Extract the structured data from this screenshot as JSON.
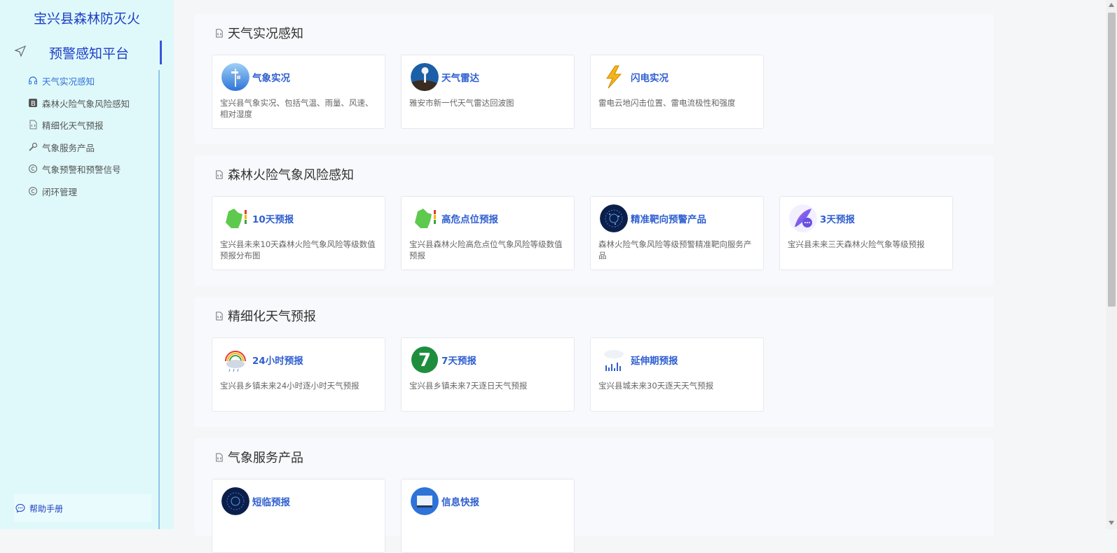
{
  "sidebar": {
    "title": "宝兴县森林防灭火",
    "platform": "预警感知平台",
    "items": [
      {
        "label": "天气实况感知",
        "icon": "headset-icon"
      },
      {
        "label": "森林火险气象风险感知",
        "icon": "b-badge-icon"
      },
      {
        "label": "精细化天气预报",
        "icon": "code-file-icon"
      },
      {
        "label": "气象服务产品",
        "icon": "wrench-icon"
      },
      {
        "label": "气象预警和预警信号",
        "icon": "copyright-icon"
      },
      {
        "label": "闭环管理",
        "icon": "copyright-icon"
      }
    ],
    "help": "帮助手册"
  },
  "sections": [
    {
      "title": "天气实况感知",
      "cards": [
        {
          "name": "气象实况",
          "desc": "宝兴县气象实况、包括气温、雨量、风速、相对湿度"
        },
        {
          "name": "天气雷达",
          "desc": "雅安市新一代天气雷达回波图"
        },
        {
          "name": "闪电实况",
          "desc": "雷电云地闪击位置、雷电流极性和强度"
        }
      ]
    },
    {
      "title": "森林火险气象风险感知",
      "cards": [
        {
          "name": "10天预报",
          "desc": "宝兴县未来10天森林火险气象风险等级数值预报分布图"
        },
        {
          "name": "高危点位预报",
          "desc": "宝兴县森林火险高危点位气象风险等级数值预报"
        },
        {
          "name": "精准靶向预警产品",
          "desc": "森林火险气象风险等级预警精准靶向服务产品"
        },
        {
          "name": "3天预报",
          "desc": "宝兴县未来三天森林火险气象等级预报"
        }
      ]
    },
    {
      "title": "精细化天气预报",
      "cards": [
        {
          "name": "24小时预报",
          "desc": "宝兴县乡镇未来24小时逐小时天气预报"
        },
        {
          "name": "7天预报",
          "desc": "宝兴县乡镇未来7天逐日天气预报",
          "badge": "7"
        },
        {
          "name": "延伸期预报",
          "desc": "宝兴县城未来30天逐天天气预报"
        }
      ]
    },
    {
      "title": "气象服务产品",
      "cards": [
        {
          "name": "短临预报",
          "desc": ""
        },
        {
          "name": "信息快报",
          "desc": ""
        }
      ]
    }
  ],
  "colors": {
    "sidebar_bg": "#dff9fb",
    "accent": "#1d3ec4",
    "card_title": "#2f5fd0"
  }
}
